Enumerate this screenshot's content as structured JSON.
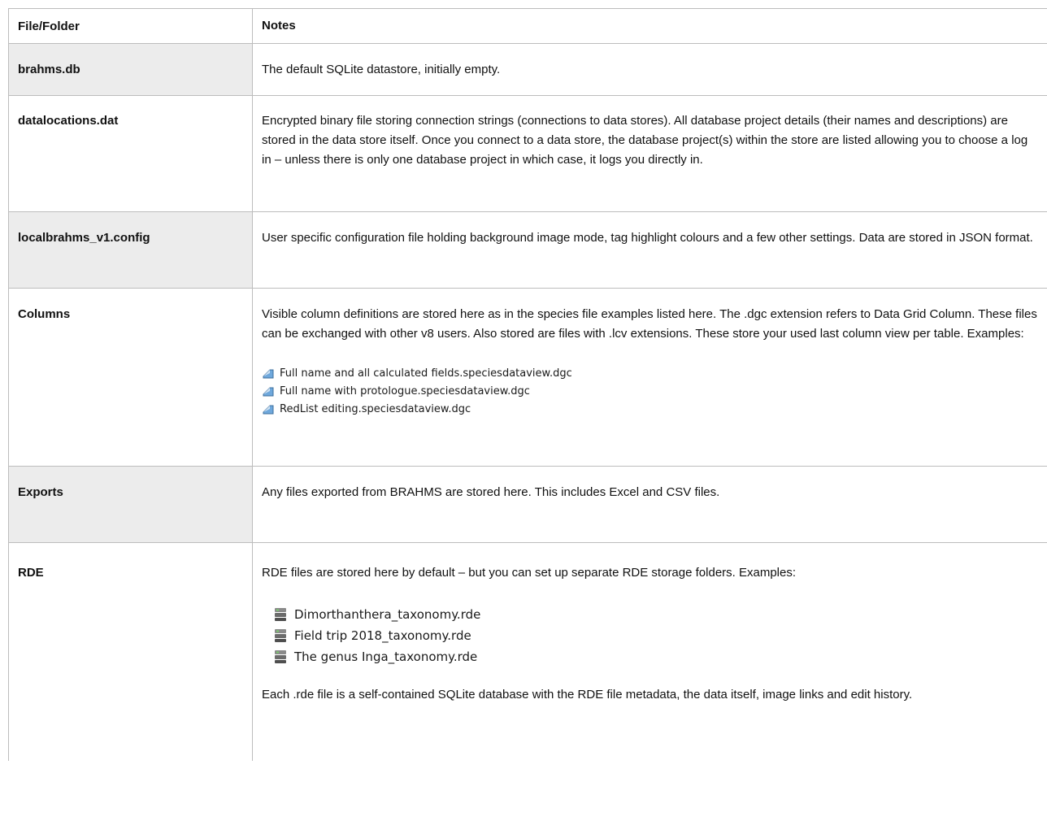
{
  "table": {
    "header": {
      "col1": "File/Folder",
      "col2": "Notes"
    },
    "rows": [
      {
        "name": "brahms.db",
        "notes": "The default SQLite datastore, initially empty."
      },
      {
        "name": "datalocations.dat",
        "notes": "Encrypted binary file storing connection strings (connections to data stores). All database project details (their names and descriptions) are stored in the data store itself. Once you connect to a data store, the database project(s) within the store are listed allowing you to choose a log in – unless there is only one database project in which case, it logs you directly in."
      },
      {
        "name": "localbrahms_v1.config",
        "notes": "User specific configuration file holding background image mode, tag highlight colours and a few other settings. Data are stored in JSON format."
      },
      {
        "name": "Columns",
        "notes": "Visible column definitions are stored here as in the species file examples listed here. The .dgc extension refers to Data Grid Column. These files can be exchanged with other v8 users. Also stored are files with .lcv extensions. These store your used last column view per table. Examples:",
        "files": [
          "Full name and all calculated fields.speciesdataview.dgc",
          "Full name with protologue.speciesdataview.dgc",
          "RedList editing.speciesdataview.dgc"
        ]
      },
      {
        "name": "Exports",
        "notes": "Any files exported from BRAHMS are stored here. This includes Excel and CSV files."
      },
      {
        "name": "RDE",
        "notes": "RDE files are stored here by default – but you can set up separate RDE storage folders. Examples:",
        "files": [
          "Dimorthanthera_taxonomy.rde",
          "Field trip 2018_taxonomy.rde",
          "The genus Inga_taxonomy.rde"
        ],
        "notes_after": "Each .rde file is a self-contained SQLite database with the RDE file metadata, the data itself, image links and edit history."
      }
    ]
  },
  "icons": {
    "dgc_file": "document-icon",
    "rde_file": "database-icon"
  },
  "colors": {
    "shaded_cell": "#ececec",
    "border": "#bdbdbd"
  }
}
